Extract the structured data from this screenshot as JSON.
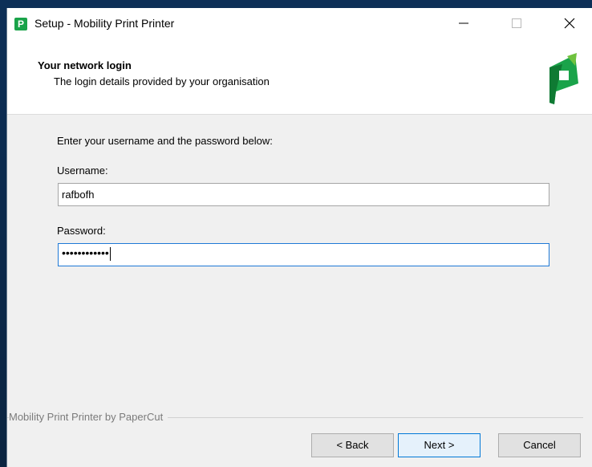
{
  "window": {
    "title": "Setup - Mobility Print Printer",
    "app_icon_letter": "P",
    "controls": {
      "minimize": "minimize-icon",
      "maximize": "maximize-icon",
      "close": "close-icon"
    }
  },
  "header": {
    "title": "Your network login",
    "subtitle": "The login details provided by your organisation",
    "logo": "papercut-logo"
  },
  "form": {
    "instruction": "Enter your username and the password below:",
    "username_label": "Username:",
    "username_value": "rafbofh",
    "password_label": "Password:",
    "password_masked": "••••••••••••"
  },
  "footer": {
    "brand": "Mobility Print Printer by PaperCut",
    "back_label": "< Back",
    "next_label": "Next >",
    "cancel_label": "Cancel"
  },
  "colors": {
    "brand_green": "#1aa34a",
    "logo_dark_green": "#0f7a33",
    "logo_light_green": "#6fc23e",
    "focus_blue": "#1e79d6"
  }
}
